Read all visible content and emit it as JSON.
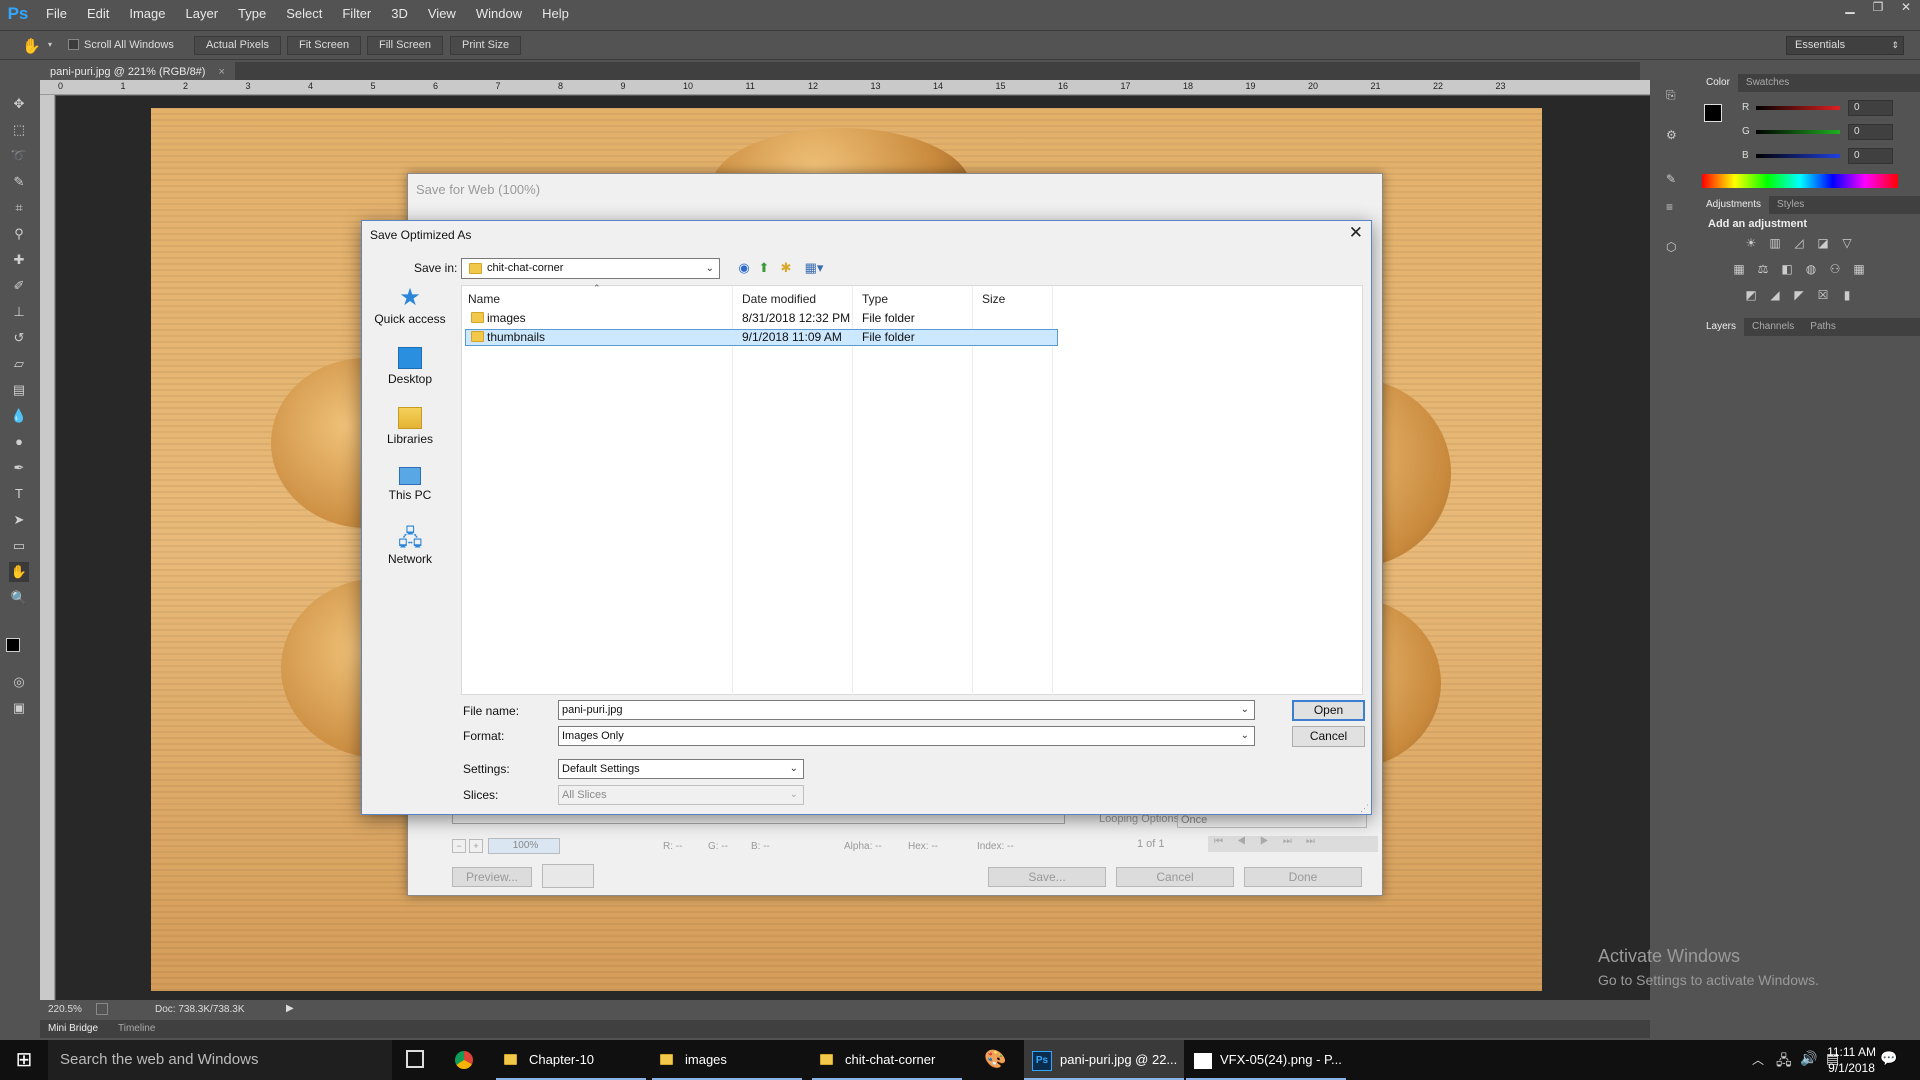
{
  "app": {
    "logo": "Ps"
  },
  "menubar": {
    "items": [
      "File",
      "Edit",
      "Image",
      "Layer",
      "Type",
      "Select",
      "Filter",
      "3D",
      "View",
      "Window",
      "Help"
    ]
  },
  "window_controls": {
    "minimize": "▁",
    "restore": "❐",
    "close": "✕"
  },
  "options_bar": {
    "tool_icon": "hand-icon",
    "scroll_all_windows": "Scroll All Windows",
    "buttons": [
      "Actual Pixels",
      "Fit Screen",
      "Fill Screen",
      "Print Size"
    ],
    "workspace": "Essentials"
  },
  "document_tab": {
    "title": "pani-puri.jpg @ 221% (RGB/8#)",
    "close": "×"
  },
  "ruler": {
    "top": [
      "0",
      "1",
      "2",
      "3",
      "4",
      "5",
      "6",
      "7",
      "8",
      "9",
      "10",
      "11",
      "12",
      "13",
      "14",
      "15",
      "16",
      "17",
      "18",
      "19",
      "20",
      "21",
      "22",
      "23"
    ]
  },
  "status_bar": {
    "zoom": "220.5%",
    "doc": "Doc: 738.3K/738.3K"
  },
  "bottom_tabs": [
    "Mini Bridge",
    "Timeline"
  ],
  "panels": {
    "color_tabs": [
      "Color",
      "Swatches"
    ],
    "channels": [
      {
        "label": "R",
        "value": "0",
        "color": "#e02020"
      },
      {
        "label": "G",
        "value": "0",
        "color": "#20b020"
      },
      {
        "label": "B",
        "value": "0",
        "color": "#2040e0"
      }
    ],
    "adjustment_tabs": [
      "Adjustments",
      "Styles"
    ],
    "add_adjustment": "Add an adjustment",
    "layer_tabs": [
      "Layers",
      "Channels",
      "Paths"
    ]
  },
  "watermark": {
    "line1": "Activate Windows",
    "line2": "Go to Settings to activate Windows."
  },
  "save_for_web": {
    "title": "Save for Web (100%)",
    "zoom": "100%",
    "readouts": {
      "r": "R: --",
      "g": "G: --",
      "b": "B: --",
      "alpha": "Alpha: --",
      "hex": "Hex: --",
      "index": "Index: --"
    },
    "looping_label": "Looping Options:",
    "looping_value": "Once",
    "frame": "1 of 1",
    "buttons": {
      "preview": "Preview...",
      "save": "Save...",
      "cancel": "Cancel",
      "done": "Done"
    }
  },
  "save_dialog": {
    "title": "Save Optimized As",
    "save_in_label": "Save in:",
    "save_in_value": "chit-chat-corner",
    "places": [
      "Quick access",
      "Desktop",
      "Libraries",
      "This PC",
      "Network"
    ],
    "columns": [
      "Name",
      "Date modified",
      "Type",
      "Size"
    ],
    "files": [
      {
        "name": "images",
        "date": "8/31/2018 12:32 PM",
        "type": "File folder",
        "size": ""
      },
      {
        "name": "thumbnails",
        "date": "9/1/2018 11:09 AM",
        "type": "File folder",
        "size": ""
      }
    ],
    "file_name_label": "File name:",
    "file_name_value": "pani-puri.jpg",
    "format_label": "Format:",
    "format_value": "Images Only",
    "settings_label": "Settings:",
    "settings_value": "Default Settings",
    "slices_label": "Slices:",
    "slices_value": "All Slices",
    "open_button": "Open",
    "cancel_button": "Cancel"
  },
  "taskbar": {
    "search_placeholder": "Search the web and Windows",
    "items": [
      "Chapter-10",
      "images",
      "chit-chat-corner",
      "pani-puri.jpg @ 22...",
      "VFX-05(24).png - P..."
    ],
    "time": "11:11 AM",
    "date": "9/1/2018"
  }
}
